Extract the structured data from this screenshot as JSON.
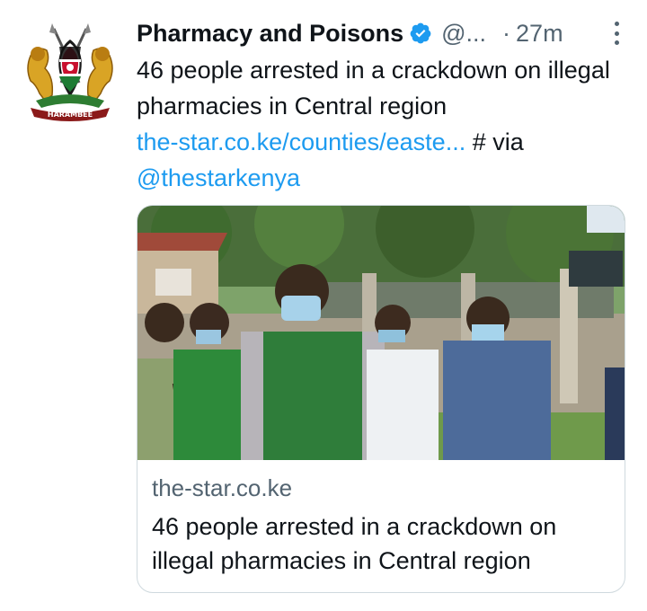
{
  "tweet": {
    "author_name": "Pharmacy and Poisons",
    "handle": "@...",
    "separator": "·",
    "time": "27m",
    "text_main": "46 people arrested in a crackdown on illegal pharmacies in Central region",
    "link_text": "the-star.co.ke/counties/easte...",
    "text_suffix": " # via",
    "mention": "@thestarkenya",
    "avatar_motto": "HARAMBEE"
  },
  "card": {
    "domain": "the-star.co.ke",
    "title": "46 people arrested in a crackdown on illegal pharmacies in Central region"
  },
  "colors": {
    "link": "#1d9bf0",
    "secondary_text": "#536471",
    "verified_badge": "#1d9bf0"
  },
  "icons": {
    "verified": "verified-badge-icon",
    "more": "more-options-icon"
  }
}
